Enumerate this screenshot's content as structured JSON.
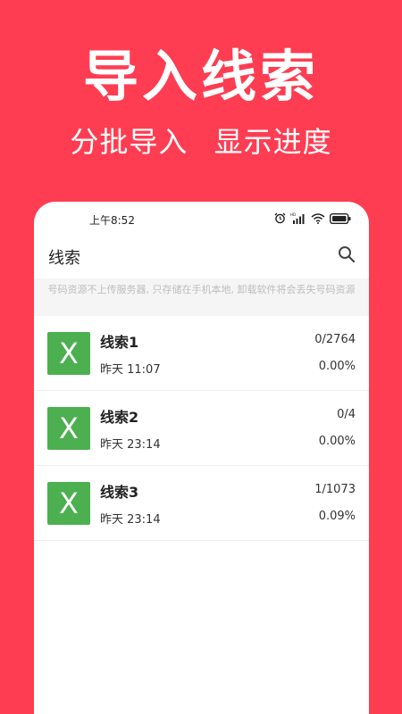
{
  "promo": {
    "title": "导入线索",
    "subtitle": "分批导入 显示进度"
  },
  "status_bar": {
    "time": "上午8:52",
    "icons": [
      "alarm-icon",
      "hd-signal-icon",
      "wifi-icon",
      "battery-icon"
    ]
  },
  "app_bar": {
    "title": "线索",
    "search_icon": "search-icon"
  },
  "notice": "号码资源不上传服务器, 只存储在手机本地, 卸载软件将会丢失号码资源",
  "colors": {
    "background": "#fe3d52",
    "file_icon": "#4caf50"
  },
  "leads": [
    {
      "icon_letter": "X",
      "name": "线索1",
      "date": "昨天 11:07",
      "count": "0/2764",
      "percent": "0.00%"
    },
    {
      "icon_letter": "X",
      "name": "线索2",
      "date": "昨天 23:14",
      "count": "0/4",
      "percent": "0.00%"
    },
    {
      "icon_letter": "X",
      "name": "线索3",
      "date": "昨天 23:14",
      "count": "1/1073",
      "percent": "0.09%"
    }
  ]
}
